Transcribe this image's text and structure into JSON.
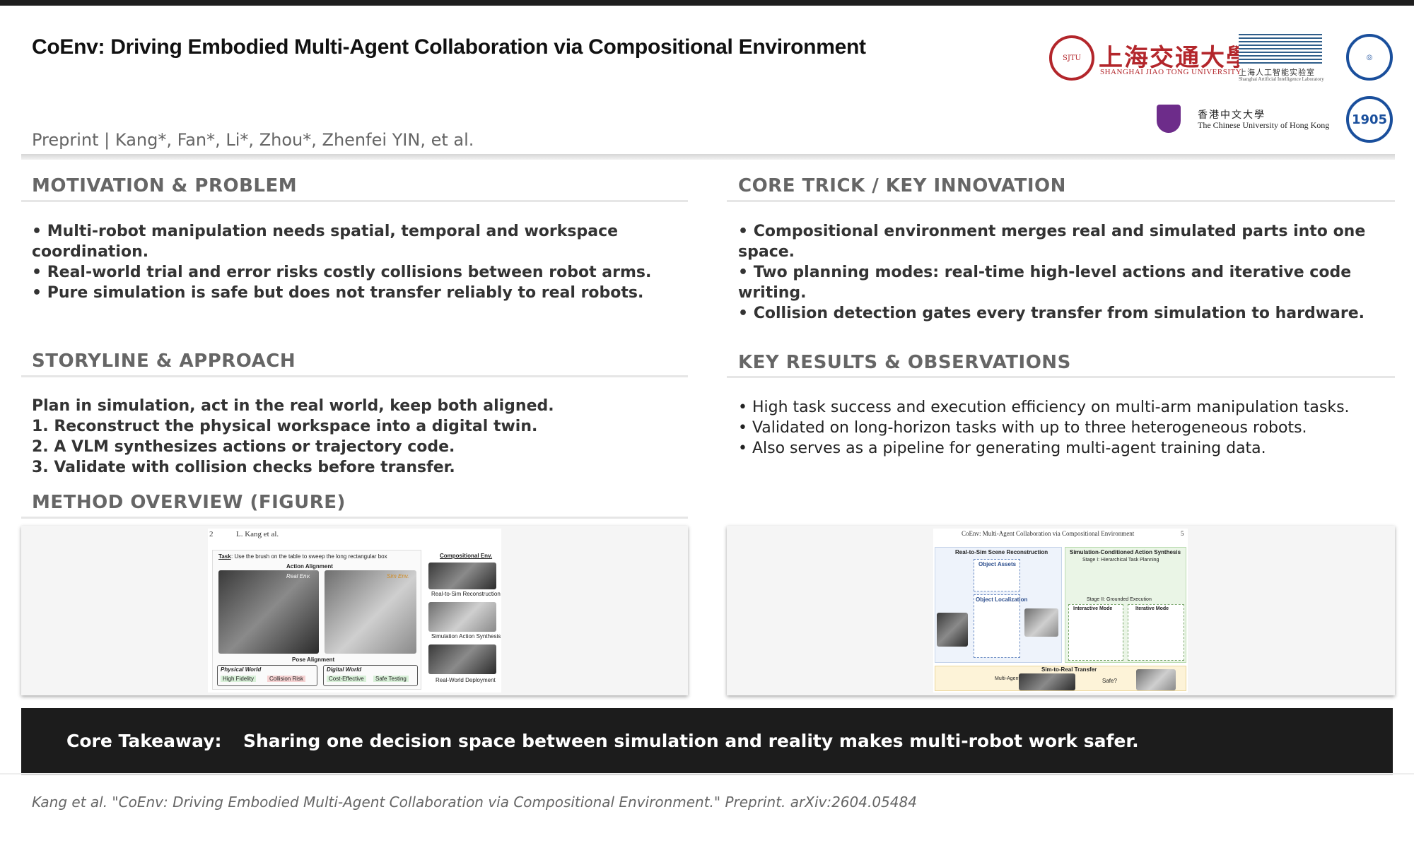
{
  "header": {
    "title": "CoEnv: Driving Embodied Multi-Agent Collaboration via Compositional Environment",
    "authors": "Preprint | Kang*, Fan*, Li*, Zhou*, Zhenfei YIN, et al."
  },
  "logos": {
    "sjtu_cn": "上海交通大學",
    "sjtu_en": "SHANGHAI JIAO TONG UNIVERSITY",
    "ai_lab_cn": "上海人工智能实验室",
    "ai_lab_en": "Shanghai Artificial Intelligence Laboratory",
    "cuhk_cn": "香港中文大學",
    "cuhk_en": "The Chinese University of Hong Kong",
    "fudan_year": "1905"
  },
  "sections": {
    "motivation": {
      "heading": "MOTIVATION & PROBLEM",
      "bullets": [
        "•  Multi-robot manipulation needs spatial, temporal and workspace coordination.",
        "•  Real-world trial and error risks costly collisions between robot arms.",
        "•  Pure simulation is safe but does not transfer reliably to real robots."
      ]
    },
    "core_trick": {
      "heading": "CORE TRICK / KEY INNOVATION",
      "bullets": [
        "•  Compositional environment merges real and simulated parts into one space.",
        "•  Two planning modes: real-time high-level actions and iterative code writing.",
        "•  Collision detection gates every transfer from simulation to hardware."
      ]
    },
    "storyline": {
      "heading": "STORYLINE & APPROACH",
      "lines": [
        "Plan in simulation, act in the real world, keep both aligned.",
        "1. Reconstruct the physical workspace into a digital twin.",
        "2. A VLM synthesizes actions or trajectory code.",
        "3. Validate with collision checks before transfer."
      ]
    },
    "results": {
      "heading": "KEY RESULTS & OBSERVATIONS",
      "bullets": [
        "•  High task success and execution efficiency on multi-arm manipulation tasks.",
        "•  Validated on long-horizon tasks with up to three heterogeneous robots.",
        "•  Also serves as a pipeline for generating multi-agent training data."
      ]
    },
    "method": {
      "heading": "METHOD OVERVIEW (FIGURE)"
    }
  },
  "figure_left": {
    "page_num": "2",
    "running_head": "L. Kang et al.",
    "task_label": "Task",
    "task_text": ": Use the brush on the table to sweep the long rectangular box",
    "action_alignment": "Action Alignment",
    "real_env": "Real Env.",
    "sim_env": "Sim Env.",
    "pose_alignment": "Pose Alignment",
    "physical_world": "Physical World",
    "digital_world": "Digital World",
    "high_fidelity": "High Fidelity",
    "collision_risk": "Collision Risk",
    "cost_effective": "Cost-Effective",
    "safe_testing": "Safe Testing",
    "compositional_env": "Compositional Env.",
    "real_to_sim": "Real-to-Sim Reconstruction",
    "sim_action": "Simulation Action Synthesis",
    "real_deploy": "Real-World Deployment"
  },
  "figure_right": {
    "running_head": "CoEnv: Multi-Agent Collaboration via Compositional Environment",
    "page_num": "5",
    "real_to_sim": "Real-to-Sim Scene Reconstruction",
    "sim_conditioned": "Simulation-Conditioned Action Synthesis",
    "object_assets": "Object Assets",
    "object_localization": "Object Localization",
    "stage1": "Stage I: Hierarchical Task Planning",
    "stage2": "Stage II: Grounded Execution",
    "interactive_mode": "Interactive Mode",
    "iterative_mode": "Iterative Mode",
    "sim_to_real": "Sim-to-Real Transfer",
    "safe": "Safe?",
    "multi_agent_deploy": "Multi-Agent Deployment"
  },
  "takeaway": {
    "label": "Core Takeaway:",
    "text": "Sharing one decision space between simulation and reality makes multi-robot work safer."
  },
  "citation": "Kang et al. \"CoEnv: Driving Embodied Multi-Agent Collaboration via Compositional Environment.\" Preprint. arXiv:2604.05484"
}
